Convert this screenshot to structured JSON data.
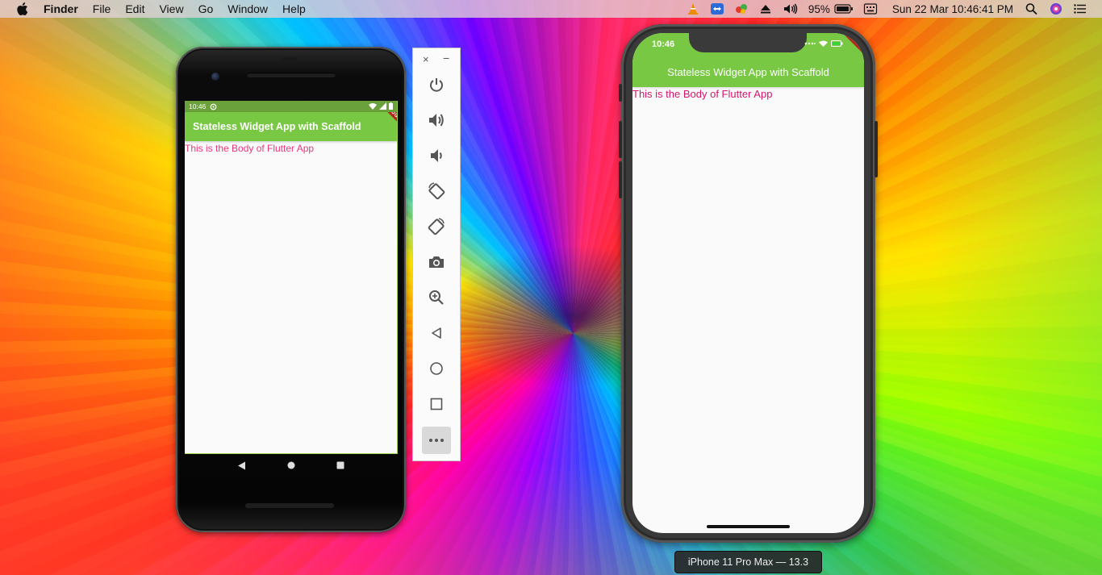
{
  "menubar": {
    "app_name": "Finder",
    "items": [
      "File",
      "Edit",
      "View",
      "Go",
      "Window",
      "Help"
    ],
    "battery_percent": "95%",
    "datetime": "Sun 22 Mar  10:46:41 PM"
  },
  "android": {
    "status_time": "10:46",
    "appbar_title": "Stateless Widget App with Scaffold",
    "debug_banner": "DEBUG",
    "body_text": "This is the Body of Flutter App"
  },
  "emulator_toolbar": {
    "close": "×",
    "minimize": "−",
    "buttons": [
      "power",
      "volume-up",
      "volume-down",
      "rotate-left",
      "rotate-right",
      "screenshot",
      "zoom",
      "back",
      "home",
      "overview",
      "more"
    ]
  },
  "iphone": {
    "status_time": "10:46",
    "appbar_title": "Stateless Widget App with Scaffold",
    "debug_banner": "DEBUG",
    "body_text": "This is the Body of Flutter App"
  },
  "device_label": "iPhone 11 Pro Max — 13.3",
  "colors": {
    "appbar_green": "#79c843",
    "android_body_text": "#e8397c",
    "ios_body_text": "#d6156c",
    "debug_red": "#b3261e"
  }
}
